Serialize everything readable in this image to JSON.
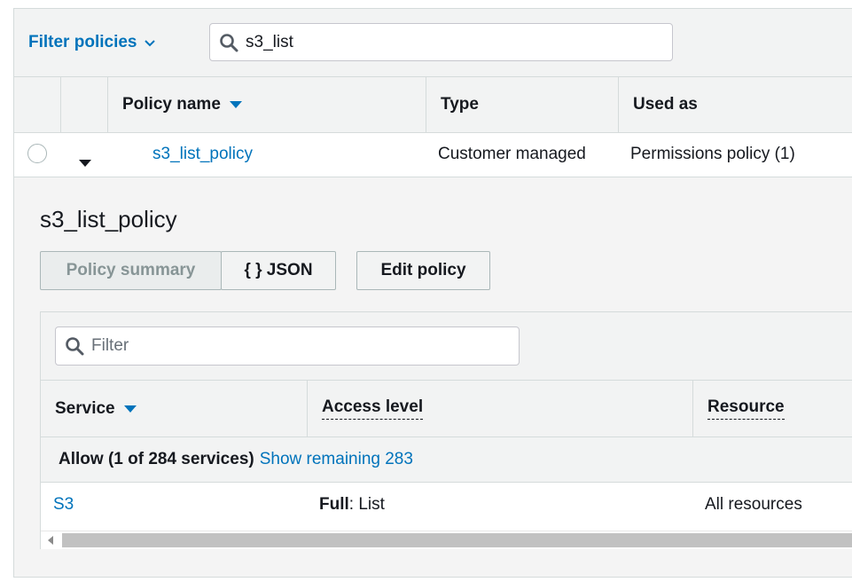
{
  "filter_bar": {
    "dropdown_label": "Filter policies",
    "search_value": "s3_list"
  },
  "table": {
    "headers": {
      "policy_name": "Policy name",
      "type": "Type",
      "used_as": "Used as"
    },
    "row": {
      "policy_name": "s3_list_policy",
      "type": "Customer managed",
      "used_as": "Permissions policy (1)"
    }
  },
  "detail": {
    "title": "s3_list_policy",
    "tabs": {
      "summary": "Policy summary",
      "json": "{ } JSON"
    },
    "edit_button": "Edit policy",
    "filter_placeholder": "Filter",
    "columns": {
      "service": "Service",
      "access_level": "Access level",
      "resource": "Resource"
    },
    "allow": {
      "label": "Allow (1 of 284 services)",
      "link": "Show remaining 283"
    },
    "service_row": {
      "service": "S3",
      "access_strong": "Full",
      "access_rest": ": List",
      "resource": "All resources"
    }
  },
  "icons": {
    "search": "search-icon",
    "chevron": "chevron-down-icon",
    "sort": "sort-down-icon",
    "expand": "caret-down-icon"
  },
  "colors": {
    "link": "#0073bb",
    "header_bg": "#f2f3f3",
    "border": "#d5dbdb"
  }
}
